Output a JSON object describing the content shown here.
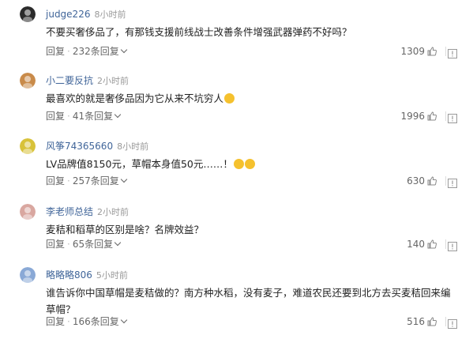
{
  "comments": [
    {
      "username": "judge226",
      "time": "8小时前",
      "text": "不要买奢侈品了，有那钱支援前线战士改善条件增强武器弹药不好吗？",
      "text2": "",
      "emojis": 0,
      "reply_label": "回复",
      "replies_label": "232条回复",
      "likes": "1309",
      "avatar_color": "#2b2b2b"
    },
    {
      "username": "小二要反抗",
      "time": "2小时前",
      "text": "最喜欢的就是奢侈品因为它从来不坑穷人",
      "text2": "",
      "emojis": 1,
      "reply_label": "回复",
      "replies_label": "41条回复",
      "likes": "1996",
      "avatar_color": "#c98b4a"
    },
    {
      "username": "风筝74365660",
      "time": "8小时前",
      "text": "LV品牌值8150元，草帽本身值50元……！",
      "text2": "",
      "emojis": 2,
      "reply_label": "回复",
      "replies_label": "257条回复",
      "likes": "630",
      "avatar_color": "#d8c23a"
    },
    {
      "username": "李老师总结",
      "time": "2小时前",
      "text": "麦秸和稻草的区别是啥？名牌效益？",
      "text2": "",
      "emojis": 0,
      "reply_label": "回复",
      "replies_label": "65条回复",
      "likes": "140",
      "avatar_color": "#d9a7a0"
    },
    {
      "username": "略略略806",
      "time": "5小时前",
      "text": "谁告诉你中国草帽是麦秸做的？南方种水稻，没有麦子，难道农民还要到北方去买麦秸回来编",
      "text2": "草帽？",
      "emojis": 0,
      "reply_label": "回复",
      "replies_label": "166条回复",
      "likes": "516",
      "avatar_color": "#8aa9d6"
    }
  ]
}
